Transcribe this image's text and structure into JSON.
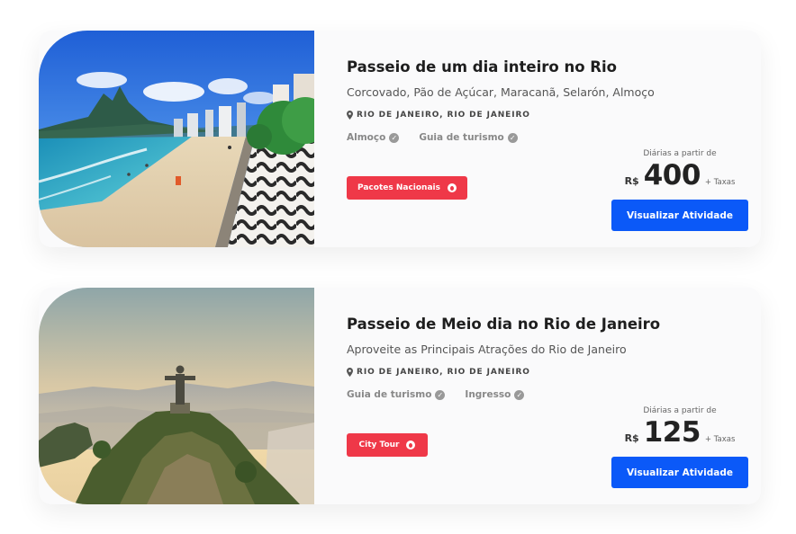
{
  "activities": [
    {
      "title": "Passeio de um dia inteiro no Rio",
      "subtitle": "Corcovado, Pão de Açúcar, Maracanã, Selarón, Almoço",
      "location": "RIO DE JANEIRO, RIO DE JANEIRO",
      "features": [
        "Almoço",
        "Guia de turismo"
      ],
      "tag": "Pacotes Nacionais",
      "price_caption": "Diárias a partir de",
      "currency": "R$",
      "price": "400",
      "taxes": "+ Taxas",
      "cta": "Visualizar Atividade"
    },
    {
      "title": "Passeio de Meio dia no Rio de Janeiro",
      "subtitle": "Aproveite as Principais Atrações do Rio de Janeiro",
      "location": "RIO DE JANEIRO, RIO DE JANEIRO",
      "features": [
        "Guia de turismo",
        "Ingresso"
      ],
      "tag": "City Tour",
      "price_caption": "Diárias a partir de",
      "currency": "R$",
      "price": "125",
      "taxes": "+ Taxas",
      "cta": "Visualizar Atividade"
    }
  ],
  "colors": {
    "tag_red": "#ef3848",
    "button_blue": "#0b59f8",
    "card_bg": "#fafafb"
  },
  "icons": {
    "location": "map-pin-icon",
    "feature_check": "check-circle-icon",
    "tag": "fire-icon"
  }
}
